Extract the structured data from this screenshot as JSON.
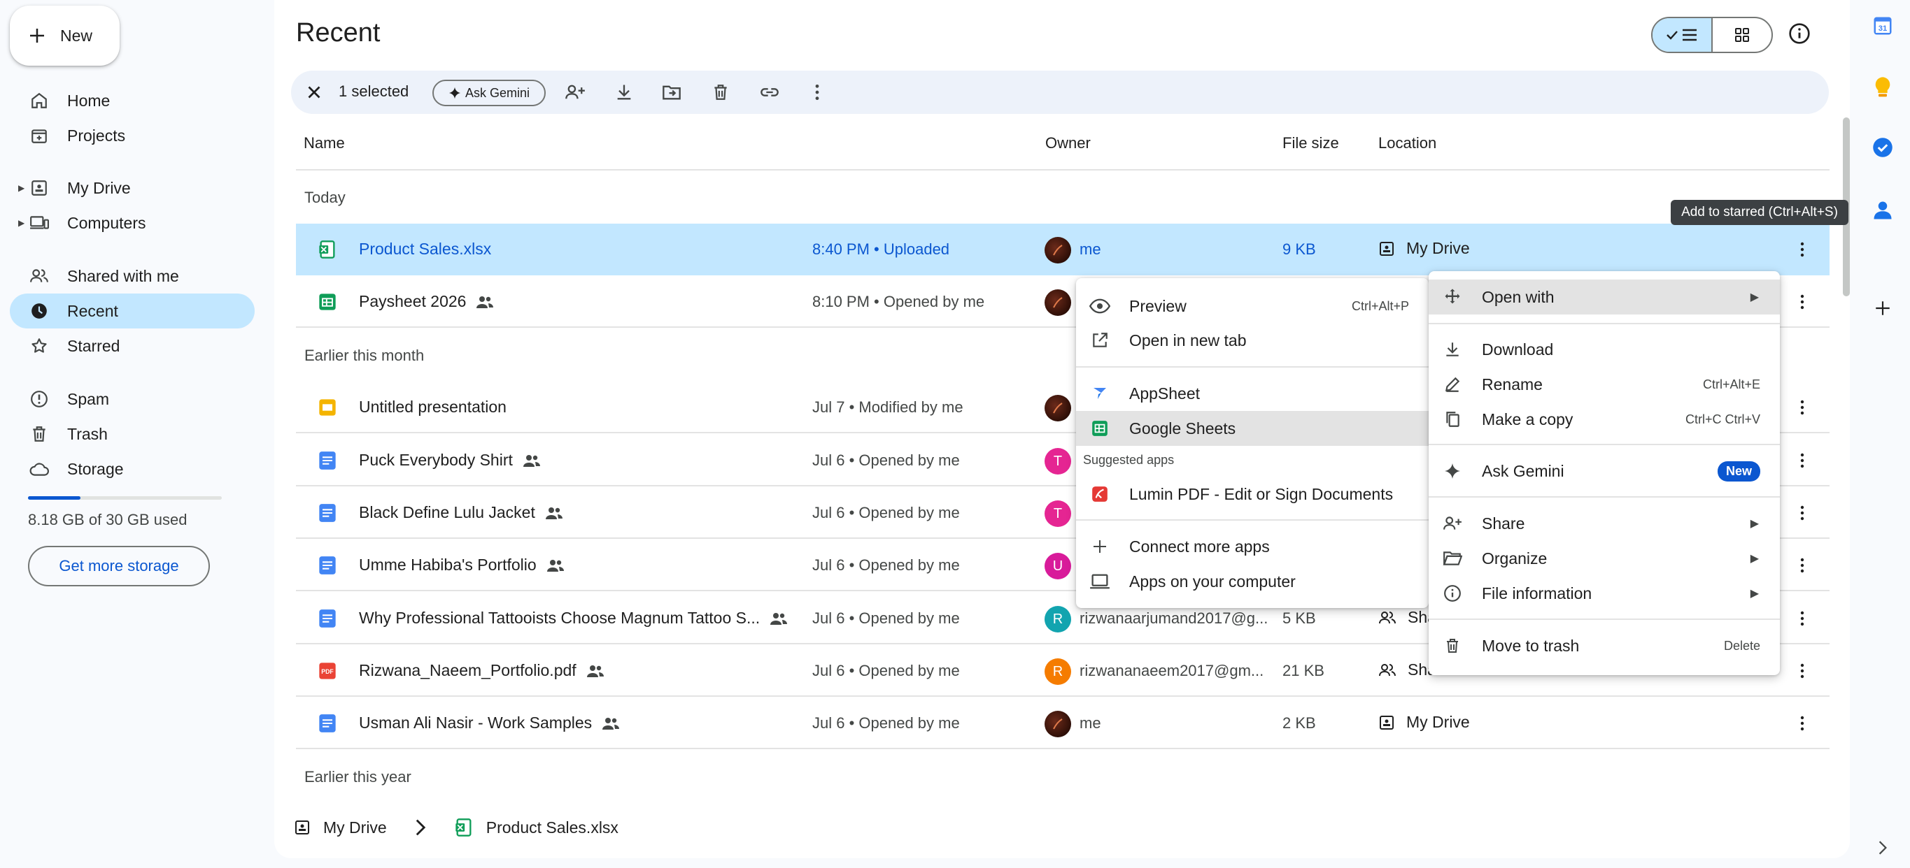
{
  "app": {
    "new_label": "New",
    "page_title": "Recent"
  },
  "sidebar": {
    "items": [
      {
        "label": "Home"
      },
      {
        "label": "Projects"
      },
      {
        "label": "My Drive"
      },
      {
        "label": "Computers"
      },
      {
        "label": "Shared with me"
      },
      {
        "label": "Recent"
      },
      {
        "label": "Starred"
      },
      {
        "label": "Spam"
      },
      {
        "label": "Trash"
      },
      {
        "label": "Storage"
      }
    ],
    "storage_text": "8.18 GB of 30 GB used",
    "storage_used_fraction": 0.27,
    "get_storage_label": "Get more storage"
  },
  "actionbar": {
    "selected_text": "1 selected",
    "gemini_label": "Ask Gemini"
  },
  "columns": {
    "name": "Name",
    "owner": "Owner",
    "size": "File size",
    "location": "Location"
  },
  "sections": {
    "today": "Today",
    "earlier_month": "Earlier this month",
    "earlier_year": "Earlier this year"
  },
  "files": [
    {
      "name": "Product Sales.xlsx",
      "date": "8:40 PM • Uploaded",
      "owner": "me",
      "avatar": "",
      "size": "9 KB",
      "location": "My Drive",
      "shared": false
    },
    {
      "name": "Paysheet 2026",
      "date": "8:10 PM • Opened by me",
      "owner": "",
      "avatar": "",
      "size": "",
      "location": "",
      "shared": true
    },
    {
      "name": "Untitled presentation",
      "date": "Jul 7 • Modified by me",
      "owner": "",
      "avatar": "",
      "size": "",
      "location": "",
      "shared": false
    },
    {
      "name": "Puck Everybody Shirt",
      "date": "Jul 6 • Opened by me",
      "owner": "",
      "avatar": "T",
      "size": "",
      "location": "",
      "shared": true
    },
    {
      "name": "Black Define Lulu Jacket",
      "date": "Jul 6 • Opened by me",
      "owner": "",
      "avatar": "T",
      "size": "",
      "location": "",
      "shared": true
    },
    {
      "name": "Umme Habiba's Portfolio",
      "date": "Jul 6 • Opened by me",
      "owner": "",
      "avatar": "U",
      "size": "",
      "location": "",
      "shared": true
    },
    {
      "name": "Why Professional Tattooists Choose Magnum Tattoo S...",
      "date": "Jul 6 • Opened by me",
      "owner": "rizwanaarjumand2017@g...",
      "avatar": "R",
      "size": "5 KB",
      "location": "Sha",
      "shared": true
    },
    {
      "name": "Rizwana_Naeem_Portfolio.pdf",
      "date": "Jul 6 • Opened by me",
      "owner": "rizwananaeem2017@gm...",
      "avatar": "R",
      "size": "21 KB",
      "location": "Shared with me",
      "shared": true
    },
    {
      "name": "Usman Ali Nasir - Work Samples",
      "date": "Jul 6 • Opened by me",
      "owner": "me",
      "avatar": "",
      "size": "2 KB",
      "location": "My Drive",
      "shared": true
    }
  ],
  "breadcrumb": {
    "root": "My Drive",
    "file": "Product Sales.xlsx"
  },
  "tooltip": "Add to starred (Ctrl+Alt+S)",
  "context_menu": {
    "open_with": "Open with",
    "download": "Download",
    "rename": "Rename",
    "rename_sc": "Ctrl+Alt+E",
    "copy": "Make a copy",
    "copy_sc": "Ctrl+C Ctrl+V",
    "gemini": "Ask Gemini",
    "gemini_badge": "New",
    "share": "Share",
    "organize": "Organize",
    "info": "File information",
    "trash": "Move to trash",
    "trash_sc": "Delete"
  },
  "open_with_menu": {
    "preview": "Preview",
    "preview_sc": "Ctrl+Alt+P",
    "new_tab": "Open in new tab",
    "appsheet": "AppSheet",
    "sheets": "Google Sheets",
    "suggested": "Suggested apps",
    "lumin": "Lumin PDF - Edit or Sign Documents",
    "connect": "Connect more apps",
    "computer": "Apps on your computer"
  },
  "right_rail": {
    "calendar_day": "31"
  },
  "colors": {
    "accent": "#0b57d0",
    "selected_row": "#c2e7ff",
    "sheets_green": "#0f9d58",
    "docs_blue": "#4285f4",
    "slides_yellow": "#f4b400",
    "pdf_red": "#ea4335"
  }
}
